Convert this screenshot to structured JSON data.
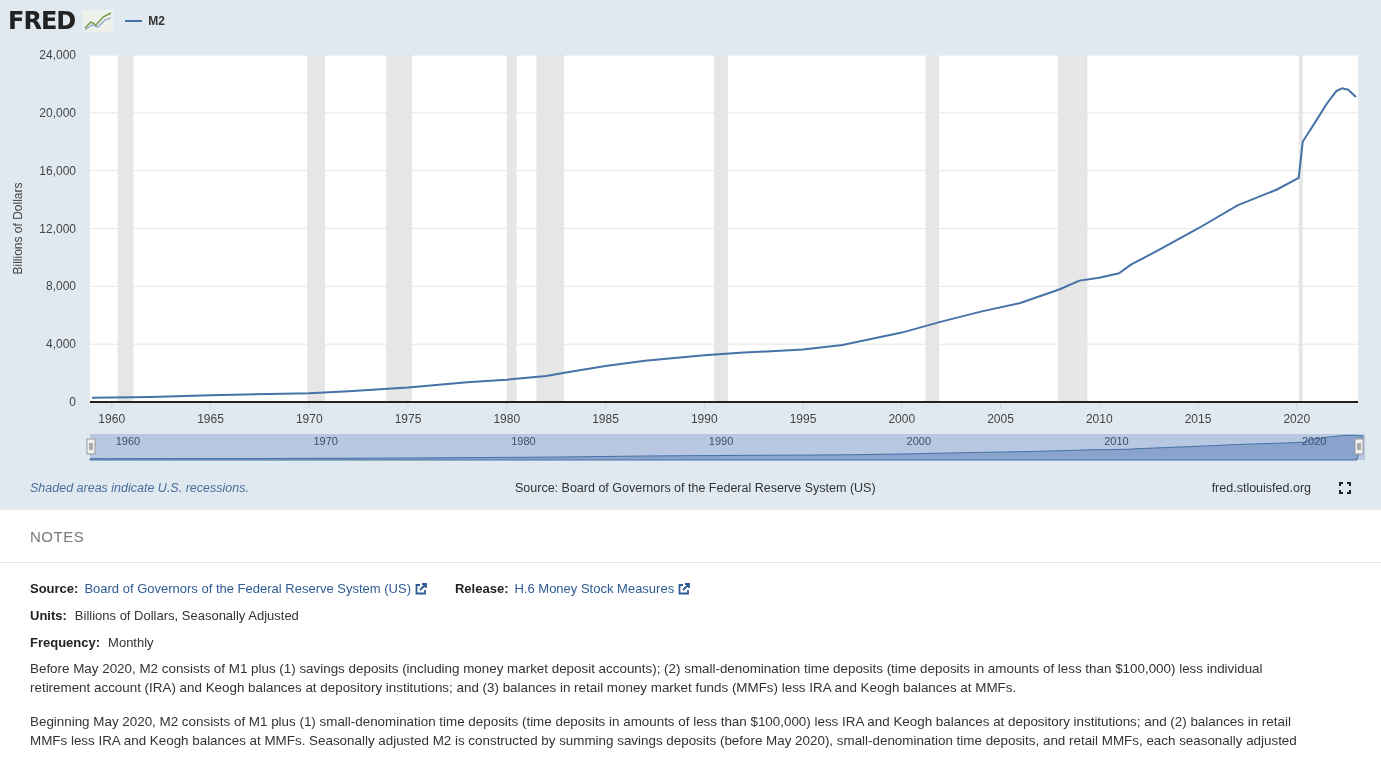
{
  "header": {
    "logo": "FRED"
  },
  "chart_data": {
    "type": "line",
    "ylabel": "Billions of Dollars",
    "x": [
      1959,
      1960,
      1962,
      1965,
      1968,
      1970,
      1972,
      1975,
      1978,
      1980,
      1982,
      1983,
      1985,
      1987,
      1990,
      1992,
      1995,
      1997,
      2000,
      2002,
      2004,
      2006,
      2008,
      2009,
      2010,
      2011,
      2011.6,
      2013,
      2015,
      2017,
      2019,
      2020.1,
      2020.3,
      2021,
      2021.5,
      2022,
      2022.3,
      2022.6,
      2023
    ],
    "series": [
      {
        "name": "M2",
        "color": "#4572a7",
        "values": [
          290,
          310,
          350,
          460,
          560,
          600,
          740,
          1000,
          1360,
          1540,
          1800,
          2050,
          2480,
          2850,
          3230,
          3420,
          3630,
          3950,
          4800,
          5560,
          6250,
          6850,
          7800,
          8400,
          8600,
          8900,
          9500,
          10500,
          12000,
          13600,
          14700,
          15500,
          18000,
          19500,
          20600,
          21500,
          21700,
          21600,
          21100
        ]
      }
    ],
    "xlim": [
      1958.9,
      2023.1
    ],
    "ylim": [
      0,
      24000
    ],
    "xticks": [
      1960,
      1965,
      1970,
      1975,
      1980,
      1985,
      1990,
      1995,
      2000,
      2005,
      2010,
      2015,
      2020
    ],
    "yticks": [
      {
        "value": 0,
        "label": "0"
      },
      {
        "value": 4000,
        "label": "4,000"
      },
      {
        "value": 8000,
        "label": "8,000"
      },
      {
        "value": 12000,
        "label": "12,000"
      },
      {
        "value": 16000,
        "label": "16,000"
      },
      {
        "value": 20000,
        "label": "20,000"
      },
      {
        "value": 24000,
        "label": "24,000"
      }
    ],
    "grid": true,
    "bands": [
      {
        "axis": "x",
        "from": 1960.3,
        "to": 1961.1
      },
      {
        "axis": "x",
        "from": 1969.9,
        "to": 1970.8
      },
      {
        "axis": "x",
        "from": 1973.9,
        "to": 1975.2
      },
      {
        "axis": "x",
        "from": 1980.0,
        "to": 1980.5
      },
      {
        "axis": "x",
        "from": 1981.5,
        "to": 1982.9
      },
      {
        "axis": "x",
        "from": 1990.5,
        "to": 1991.2
      },
      {
        "axis": "x",
        "from": 2001.2,
        "to": 2001.9
      },
      {
        "axis": "x",
        "from": 2007.9,
        "to": 2009.4
      },
      {
        "axis": "x",
        "from": 2020.1,
        "to": 2020.3
      }
    ]
  },
  "navigator": {
    "labels": [
      "1960",
      "1970",
      "1980",
      "1990",
      "2000",
      "2010",
      "2020"
    ]
  },
  "footer": {
    "recession_note": "Shaded areas indicate U.S. recessions.",
    "source": "Source: Board of Governors of the Federal Reserve System (US)",
    "site": "fred.stlouisfed.org"
  },
  "notes": {
    "title": "NOTES",
    "fields": [
      {
        "label": "Source:",
        "value": "Board of Governors of the Federal Reserve System (US)",
        "kind": "link"
      },
      {
        "label": "Release:",
        "value": "H.6 Money Stock Measures",
        "kind": "link"
      },
      {
        "label": "Units:",
        "value": "Billions of Dollars, Seasonally Adjusted",
        "kind": "text"
      },
      {
        "label": "Frequency:",
        "value": "Monthly",
        "kind": "text"
      }
    ],
    "paragraphs": [
      "Before May 2020, M2 consists of M1 plus (1) savings deposits (including money market deposit accounts); (2) small-denomination time deposits (time deposits in amounts of less than $100,000) less individual retirement account (IRA) and Keogh balances at depository institutions; and (3) balances in retail money market funds (MMFs) less IRA and Keogh balances at MMFs.",
      "Beginning May 2020, M2 consists of M1 plus (1) small-denomination time deposits (time deposits in amounts of less than $100,000) less IRA and Keogh balances at depository institutions; and (2) balances in retail MMFs less IRA and Keogh balances at MMFs. Seasonally adjusted M2 is constructed by summing savings deposits (before May 2020), small-denomination time deposits, and retail MMFs, each seasonally adjusted"
    ]
  }
}
